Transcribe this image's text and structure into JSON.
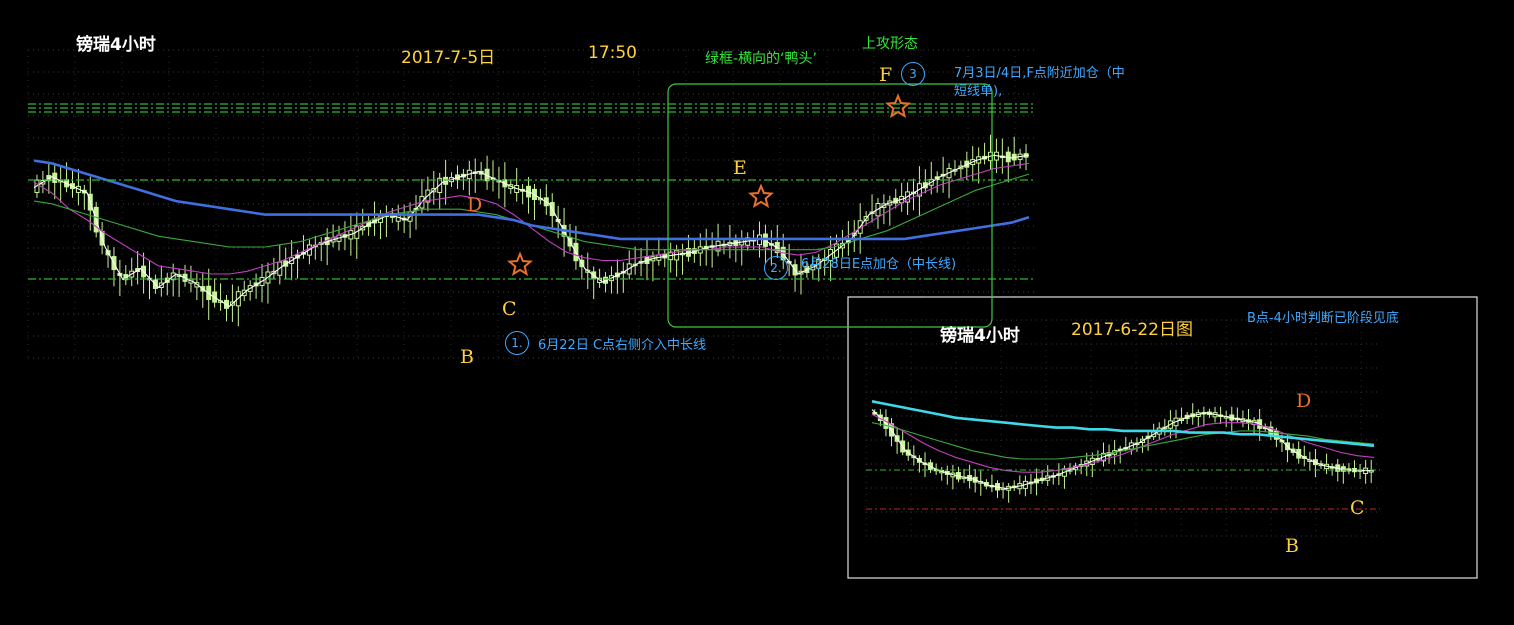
{
  "main_chart": {
    "title": "镑瑞4小时",
    "date": "2017-7-5日",
    "time": "17:50",
    "green_box_label": "绿框-横向的‘鸭头’",
    "attack_label": "上攻形态",
    "points": {
      "B": "B",
      "C": "C",
      "D": "D",
      "E": "E",
      "F": "F"
    },
    "annotations": [
      {
        "num": "1.",
        "text": "6月22日 C点右侧介入中长线"
      },
      {
        "num": "2.",
        "text": "6月28日E点加仓（中长线)"
      },
      {
        "num": "3",
        "text_line1": "7月3日/4日,F点附近加仓（中",
        "text_line2": "短线单),"
      }
    ]
  },
  "inset_chart": {
    "title": "镑瑞4小时",
    "date": "2017-6-22日图",
    "note": "B点-4小时判断已阶段见底",
    "points": {
      "B": "B",
      "C": "C",
      "D": "D"
    }
  },
  "colors": {
    "background": "#000000",
    "candle": "#c8f59a",
    "ma_white": "#ffffff",
    "ma_magenta": "#c040c0",
    "ma_green": "#3aa83a",
    "ma_blue": "#3f6fe0",
    "ma_cyan": "#3fd8e8",
    "box_green": "#3fc83f",
    "star": "#e8702c",
    "dash_green": "#2fb82f",
    "dash_red": "#c02a2a"
  },
  "chart_data": [
    {
      "type": "candlestick",
      "title": "镑瑞4小时 2017-7-5日 17:50",
      "series": [
        {
          "values": [
            62,
            66,
            63,
            60,
            40,
            28,
            32,
            25,
            30,
            27,
            22,
            18,
            24,
            28,
            33,
            37,
            41,
            43,
            45,
            49,
            52,
            50,
            58,
            64,
            66,
            68,
            65,
            62,
            60,
            56,
            44,
            32,
            27,
            30,
            34,
            36,
            37,
            38,
            40,
            41,
            42,
            43,
            39,
            30,
            33,
            38,
            43,
            52,
            56,
            58,
            62,
            66,
            69,
            72,
            74,
            73,
            74
          ]
        },
        {
          "values": [
            64,
            60,
            54,
            50,
            45,
            41,
            37,
            33,
            32,
            31,
            30,
            30,
            31,
            33,
            35,
            38,
            41,
            44,
            47,
            50,
            53,
            55,
            57,
            58,
            59,
            58,
            56,
            52,
            47,
            42,
            38,
            36,
            35,
            35,
            36,
            37,
            38,
            39,
            39,
            40,
            40,
            40,
            38,
            37,
            38,
            41,
            45,
            49,
            53,
            57,
            60,
            63,
            65,
            67,
            69,
            70,
            71
          ]
        },
        {
          "values": [
            57,
            56,
            54,
            52,
            50,
            48,
            46,
            44,
            43,
            42,
            41,
            40,
            40,
            40,
            41,
            42,
            44,
            46,
            48,
            50,
            52,
            53,
            54,
            54,
            54,
            53,
            52,
            50,
            48,
            46,
            44,
            42,
            41,
            40,
            39,
            39,
            39,
            39,
            39,
            39,
            39,
            39,
            39,
            39,
            39,
            40,
            42,
            44,
            46,
            49,
            52,
            55,
            58,
            61,
            63,
            65,
            67
          ]
        },
        {
          "values": [
            72,
            71,
            69,
            67,
            65,
            63,
            61,
            59,
            57,
            56,
            55,
            54,
            53,
            52,
            52,
            52,
            52,
            52,
            52,
            52,
            52,
            52,
            52,
            52,
            52,
            52,
            51,
            50,
            48,
            47,
            46,
            45,
            44,
            43,
            43,
            43,
            43,
            43,
            43,
            43,
            43,
            43,
            43,
            43,
            43,
            43,
            43,
            43,
            43,
            43,
            44,
            45,
            46,
            47,
            48,
            49,
            51
          ]
        }
      ]
    },
    {
      "type": "candlestick",
      "title": "镑瑞4小时 2017-6-22日图",
      "series": [
        {
          "values": [
            70,
            60,
            45,
            38,
            33,
            30,
            28,
            24,
            22,
            24,
            27,
            30,
            34,
            38,
            42,
            46,
            50,
            56,
            62,
            66,
            68,
            66,
            64,
            62,
            56,
            46,
            40,
            36,
            34,
            33,
            33
          ]
        },
        {
          "values": [
            67,
            62,
            56,
            50,
            45,
            41,
            38,
            35,
            33,
            32,
            32,
            33,
            35,
            37,
            40,
            43,
            47,
            51,
            55,
            58,
            61,
            62,
            62,
            61,
            58,
            54,
            50,
            47,
            44,
            42,
            41
          ]
        },
        {
          "values": [
            62,
            60,
            57,
            54,
            51,
            48,
            45,
            43,
            41,
            40,
            40,
            40,
            41,
            42,
            43,
            45,
            47,
            49,
            51,
            53,
            55,
            56,
            57,
            57,
            56,
            55,
            54,
            52,
            51,
            50,
            49
          ]
        },
        {
          "values": [
            75,
            73,
            71,
            69,
            67,
            65,
            64,
            63,
            62,
            61,
            60,
            59,
            59,
            58,
            58,
            57,
            57,
            57,
            57,
            56,
            56,
            56,
            55,
            55,
            54,
            53,
            52,
            51,
            50,
            49,
            48
          ]
        }
      ]
    }
  ]
}
